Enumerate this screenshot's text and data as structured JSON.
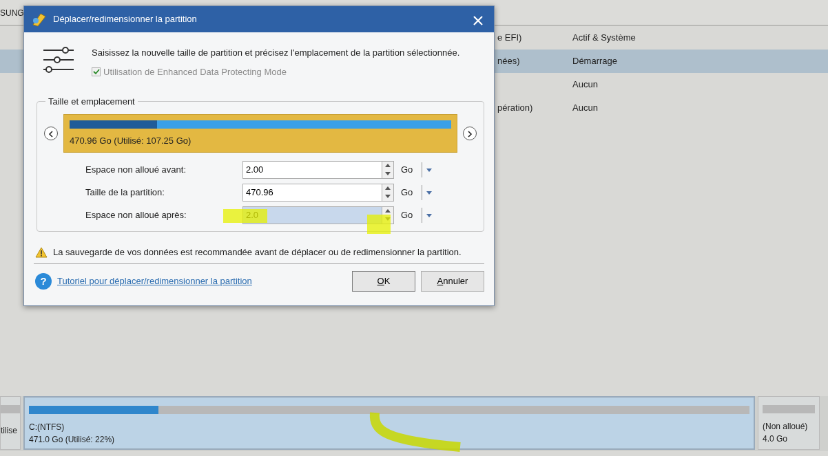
{
  "app": {
    "header_text": "SUNG",
    "partitions": [
      {
        "column_1": "e EFI)",
        "column_2": "Actif & Système",
        "selected": false
      },
      {
        "column_1": "nées)",
        "column_2": "Démarrage",
        "selected": true
      },
      {
        "column_2": "Aucun",
        "selected": false
      },
      {
        "column_1": "pération)",
        "column_2": "Aucun",
        "selected": false
      }
    ],
    "disk_map": [
      {
        "kind": "cut",
        "line_1": "tilise",
        "selected": false
      },
      {
        "kind": "partition",
        "line_1": "C:(NTFS)",
        "line_2": "471.0 Go (Utilisé: 22%)",
        "level": 0.18,
        "selected": true
      },
      {
        "kind": "unallocated",
        "line_1": "(Non alloué)",
        "line_2": "4.0 Go",
        "selected": false
      }
    ]
  },
  "dialog": {
    "title": "Déplacer/redimensionner la partition",
    "instruction": "Saisissez la nouvelle taille de partition et précisez l'emplacement de la partition sélectionnée.",
    "protect_mode": {
      "label": "Utilisation de Enhanced Data Protecting Mode",
      "checked": true,
      "disabled": true
    },
    "group_title": "Taille et emplacement",
    "partition_bar": {
      "label": "470.96 Go (Utilisé: 107.25 Go)",
      "level": 0.23
    },
    "fields": [
      {
        "label": "Espace non alloué avant:",
        "value": "2.00",
        "unit": "Go",
        "selected": false
      },
      {
        "label": "Taille de la partition:",
        "value": "470.96",
        "unit": "Go",
        "selected": false
      },
      {
        "label": "Espace non alloué après:",
        "value": "2.0",
        "unit": "Go",
        "selected": true
      }
    ],
    "warning": "La sauvegarde de vos données est recommandée avant de déplacer ou de redimensionner la partition.",
    "help_icon": "?",
    "tutorial_link": "Tutoriel pour déplacer/redimensionner la partition",
    "buttons": [
      {
        "label": "OK"
      },
      {
        "label": "Annuler"
      }
    ]
  }
}
